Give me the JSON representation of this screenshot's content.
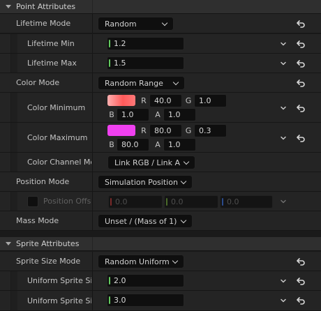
{
  "sections": {
    "point": {
      "title": "Point Attributes"
    },
    "sprite": {
      "title": "Sprite Attributes"
    }
  },
  "lifetime_mode": {
    "label": "Lifetime Mode",
    "value": "Random"
  },
  "lifetime_min": {
    "label": "Lifetime Min",
    "value": "1.2"
  },
  "lifetime_max": {
    "label": "Lifetime Max",
    "value": "1.5"
  },
  "color_mode": {
    "label": "Color Mode",
    "value": "Random Range"
  },
  "color_minimum": {
    "label": "Color Minimum",
    "swatch": "#ff7a7a",
    "r_label": "R",
    "r": "40.0",
    "g_label": "G",
    "g": "1.0",
    "b_label": "B",
    "b": "1.0",
    "a_label": "A",
    "a": "1.0"
  },
  "color_maximum": {
    "label": "Color Maximum",
    "swatch": "#f040f0",
    "r_label": "R",
    "r": "80.0",
    "g_label": "G",
    "g": "0.3",
    "b_label": "B",
    "b": "80.0",
    "a_label": "A",
    "a": "1.0"
  },
  "color_channel_mode": {
    "label": "Color Channel Mo",
    "value": "Link RGB / Link A"
  },
  "position_mode": {
    "label": "Position Mode",
    "value": "Simulation Position"
  },
  "position_offset": {
    "label": "Position Offs",
    "x": "0.0",
    "y": "0.0",
    "z": "0.0"
  },
  "mass_mode": {
    "label": "Mass Mode",
    "value": "Unset / (Mass of 1)"
  },
  "sprite_size_mode": {
    "label": "Sprite Size Mode",
    "value": "Random Uniform"
  },
  "uniform_sprite_size_min": {
    "label": "Uniform Sprite Siz",
    "value": "2.0"
  },
  "uniform_sprite_size_max": {
    "label": "Uniform Sprite Siz",
    "value": "3.0"
  },
  "icons": {
    "reset": "reset-arrow-icon",
    "expand": "chevron-down-icon",
    "section": "triangle-down-icon"
  }
}
